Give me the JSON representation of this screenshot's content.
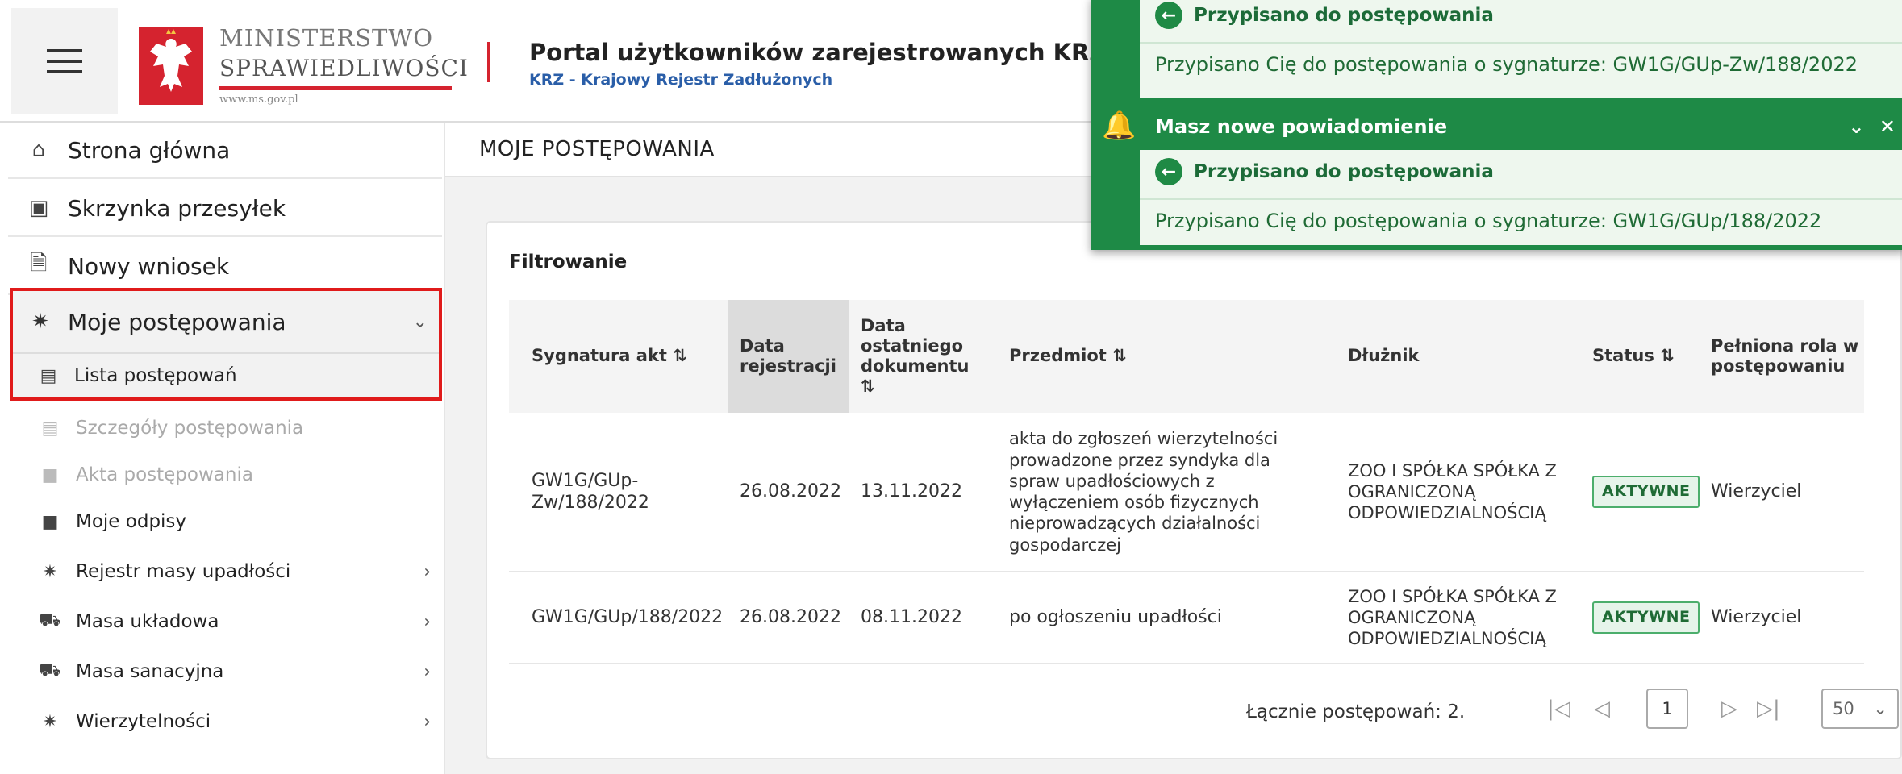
{
  "header": {
    "logo_line1": "MINISTERSTWO",
    "logo_line2": "SPRAWIEDLIWOŚCI",
    "logo_url": "www.ms.gov.pl",
    "portal_title": "Portal użytkowników zarejestrowanych KRZ",
    "portal_subtitle": "KRZ - Krajowy Rejestr Zadłużonych"
  },
  "sidebar": {
    "items": [
      {
        "label": "Strona główna",
        "icon": "home-icon"
      },
      {
        "label": "Skrzynka przesyłek",
        "icon": "inbox-icon"
      },
      {
        "label": "Nowy wniosek",
        "icon": "document-icon"
      }
    ],
    "group": {
      "label": "Moje postępowania",
      "active_sub": "Lista postępowań"
    },
    "subitems": [
      {
        "label": "Szczegóły postępowania",
        "disabled": true
      },
      {
        "label": "Akta postępowania",
        "disabled": true
      },
      {
        "label": "Moje odpisy",
        "disabled": false
      },
      {
        "label": "Rejestr masy upadłości",
        "disabled": false
      },
      {
        "label": "Masa układowa",
        "disabled": false
      },
      {
        "label": "Masa sanacyjna",
        "disabled": false
      },
      {
        "label": "Wierzytelności",
        "disabled": false
      }
    ]
  },
  "main": {
    "page_title": "MOJE POSTĘPOWANIA",
    "filter_label": "Filtrowanie",
    "columns": [
      "Sygnatura akt ⇅",
      "Data rejestracji",
      "Data ostatniego dokumentu ⇅",
      "Przedmiot ⇅",
      "Dłużnik",
      "Status ⇅",
      "Pełniona rola w postępowaniu"
    ],
    "rows": [
      {
        "sygnatura": "GW1G/GUp-Zw/188/2022",
        "data_rejestracji": "26.08.2022",
        "data_dokumentu": "13.11.2022",
        "przedmiot": "akta do zgłoszeń wierzytelności prowadzone przez syndyka dla spraw upadłościowych z wyłączeniem osób fizycznych nieprowadzących działalności gospodarczej",
        "dluznik": "ZOO I SPÓŁKA SPÓŁKA Z OGRANICZONĄ ODPOWIEDZIALNOŚCIĄ",
        "status": "AKTYWNE",
        "rola": "Wierzyciel"
      },
      {
        "sygnatura": "GW1G/GUp/188/2022",
        "data_rejestracji": "26.08.2022",
        "data_dokumentu": "08.11.2022",
        "przedmiot": "po ogłoszeniu upadłości",
        "dluznik": "ZOO I SPÓŁKA SPÓŁKA Z OGRANICZONĄ ODPOWIEDZIALNOŚCIĄ",
        "status": "AKTYWNE",
        "rola": "Wierzyciel"
      }
    ],
    "pager": {
      "total": "Łącznie postępowań: 2.",
      "page": "1",
      "page_size": "50"
    }
  },
  "notifications": {
    "first": {
      "title": "Przypisano do postępowania",
      "text": "Przypisano Cię do postępowania o sygnaturze: GW1G/GUp-Zw/188/2022"
    },
    "header": "Masz nowe powiadomienie",
    "second": {
      "title": "Przypisano do postępowania",
      "text": "Przypisano Cię do postępowania o sygnaturze: GW1G/GUp/188/2022"
    }
  }
}
